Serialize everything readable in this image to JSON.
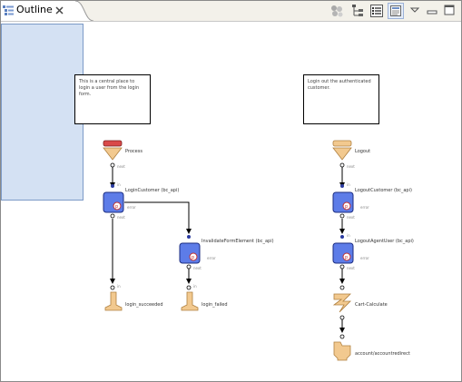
{
  "view": {
    "title": "Outline",
    "toolbar": [
      "overview-icon",
      "tree-icon",
      "list-icon",
      "properties-icon",
      "view-menu-icon",
      "minimize-icon",
      "maximize-icon"
    ]
  },
  "flow": {
    "left_note": "This is a central place to login a user from the login form.",
    "right_note": "Login out the authenticated customer.",
    "nodes": {
      "process": "Process",
      "login_customer": "LoginCustomer (bc_api)",
      "invalidate": "InvalidateFormElement (bc_api)",
      "login_succeeded": "login_succeeded",
      "login_failed": "login_failed",
      "logout": "Logout",
      "logout_customer": "LogoutCustomer (bc_api)",
      "logout_agent": "LogoutAgentUser (bc_api)",
      "cart_calculate": "Cart-Calculate",
      "account_redirect": "account/accountredirect"
    },
    "ports": {
      "next": "next",
      "in": "in",
      "error": "error"
    }
  },
  "colors": {
    "start": "#d94a4a",
    "pipelet": "#5d7ce8",
    "end": "#f2c98f",
    "selection": "#d4e1f3"
  }
}
